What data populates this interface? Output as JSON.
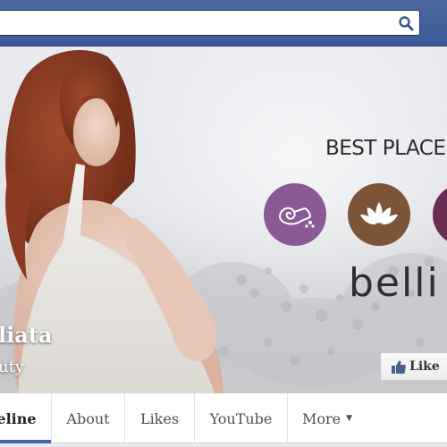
{
  "search": {
    "placeholder": "",
    "value": ""
  },
  "cover": {
    "tagline": "BEST PLACE",
    "brand": "belli",
    "page_name": "liata",
    "page_category": "uty"
  },
  "like_button": {
    "label": "Like"
  },
  "tabs": [
    {
      "label": "eline",
      "active": true
    },
    {
      "label": "About",
      "active": false
    },
    {
      "label": "Likes",
      "active": false
    },
    {
      "label": "YouTube",
      "active": false
    },
    {
      "label": "More",
      "active": false
    }
  ],
  "colors": {
    "topbar": "#3b5998",
    "circle_purple": "#8a5a95",
    "circle_brown": "#7c5437",
    "circle_plum": "#6a2e55",
    "active_tab_indicator": "#4267b2"
  },
  "icons": {
    "search": "magnifier-icon",
    "spa_towel": "rolled-towel-icon",
    "lotus": "lotus-icon",
    "like": "thumbs-up-icon",
    "more": "caret-down-icon"
  }
}
